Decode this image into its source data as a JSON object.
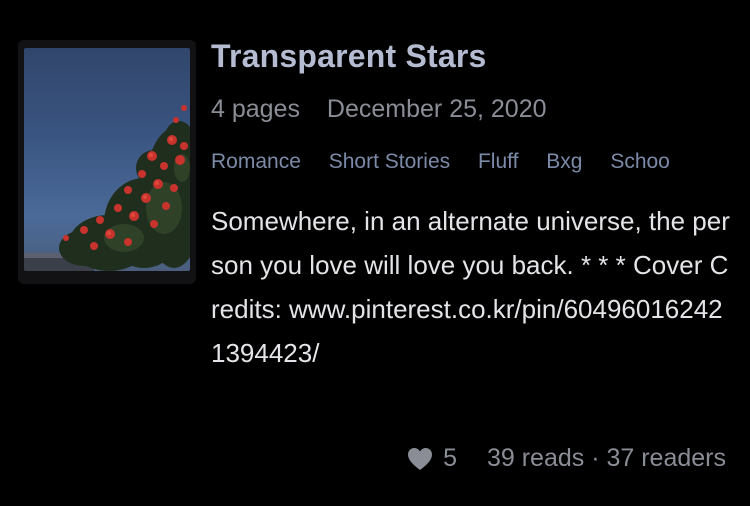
{
  "story": {
    "title": "Transparent Stars",
    "pages": "4 pages",
    "date": "December 25, 2020",
    "tags": [
      "Romance",
      "Short Stories",
      "Fluff",
      "Bxg",
      "Schoo"
    ],
    "description": "Somewhere, in an alternate universe, the person you love will love you back. * * * Cover Credits: www.pinterest.co.kr/pin/604960162421394423/",
    "cover_icon": "roses-under-night-sky-image"
  },
  "stats": {
    "heart_icon": "heart-icon",
    "likes": "5",
    "reads_readers": "39 reads · 37 readers"
  },
  "colors": {
    "background": "#000000",
    "title": "#b5bcd1",
    "meta": "#8a8d96",
    "tags": "#7b8aa7",
    "description": "#e3e4e7"
  }
}
